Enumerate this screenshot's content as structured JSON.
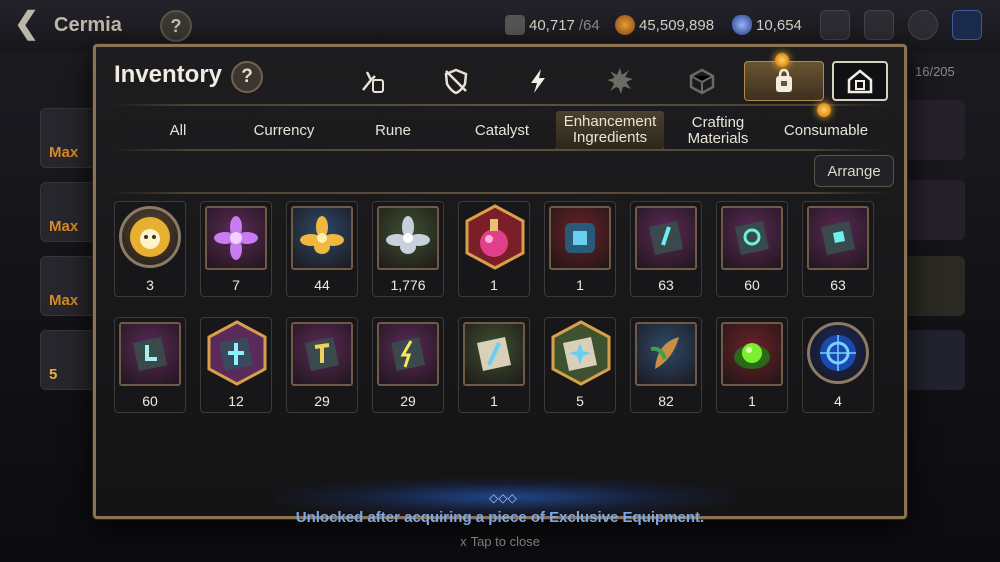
{
  "topbar": {
    "hero_name": "Cermia",
    "help": "?",
    "stamina": "40,717",
    "stamina_max": "/64",
    "gold": "45,509,898",
    "skystone": "10,654"
  },
  "background": {
    "max_labels": [
      "Max",
      "Max",
      "Max"
    ],
    "level": "5",
    "count": "16/205"
  },
  "dialog": {
    "title": "Inventory",
    "help": "?",
    "category_icons": [
      "weapon-icon",
      "shield-icon",
      "lightning-icon",
      "splatter-icon",
      "die-icon",
      "bag-icon",
      "house-icon"
    ],
    "sub_tabs": [
      "All",
      "Currency",
      "Rune",
      "Catalyst",
      "Enhancement Ingredients",
      "Crafting Materials",
      "Consumable"
    ],
    "active_sub_tab": "Enhancement Ingredients",
    "arrange": "Arrange",
    "items": [
      {
        "icon": "phantasma-icon",
        "qty": "3",
        "bg": "#5a4a32"
      },
      {
        "icon": "purple-flower-icon",
        "qty": "7",
        "bg": "#5c2a58"
      },
      {
        "icon": "gold-flower-icon",
        "qty": "44",
        "bg": "#2e4a6a"
      },
      {
        "icon": "silver-flower-icon",
        "qty": "1,776",
        "bg": "#3e5230"
      },
      {
        "icon": "potion-icon",
        "qty": "1",
        "bg": "#7a1e28"
      },
      {
        "icon": "armor-stone-icon",
        "qty": "1",
        "bg": "#6a2228"
      },
      {
        "icon": "sword-stone-icon",
        "qty": "63",
        "bg": "#5c2a58"
      },
      {
        "icon": "ring-stone-icon",
        "qty": "60",
        "bg": "#5c2a58"
      },
      {
        "icon": "gem-stone-icon",
        "qty": "63",
        "bg": "#5c2a58"
      },
      {
        "icon": "boot-stone-icon",
        "qty": "60",
        "bg": "#5c2a58"
      },
      {
        "icon": "cross-stone-icon",
        "qty": "12",
        "bg": "#5a2a5a"
      },
      {
        "icon": "hammer-stone-icon",
        "qty": "29",
        "bg": "#5c2a58"
      },
      {
        "icon": "lightning-stone-icon",
        "qty": "29",
        "bg": "#5c2a58"
      },
      {
        "icon": "feather-stone-icon",
        "qty": "1",
        "bg": "#3e5230"
      },
      {
        "icon": "star-stone-icon",
        "qty": "5",
        "bg": "#3e5230"
      },
      {
        "icon": "feather-icon",
        "qty": "82",
        "bg": "#2e4a6a"
      },
      {
        "icon": "green-orb-icon",
        "qty": "1",
        "bg": "#6a2228"
      },
      {
        "icon": "blue-orb-icon",
        "qty": "4",
        "bg": "#1a2a5a"
      }
    ]
  },
  "footer": {
    "unlock_text": "Unlocked after acquiring a piece of Exclusive Equipment.",
    "close_text": "Tap to close",
    "close_icon": "x"
  },
  "colors": {
    "accent": "#caa465",
    "dialog_border": "#8a7355",
    "unlock_text": "#7fa8e6"
  }
}
